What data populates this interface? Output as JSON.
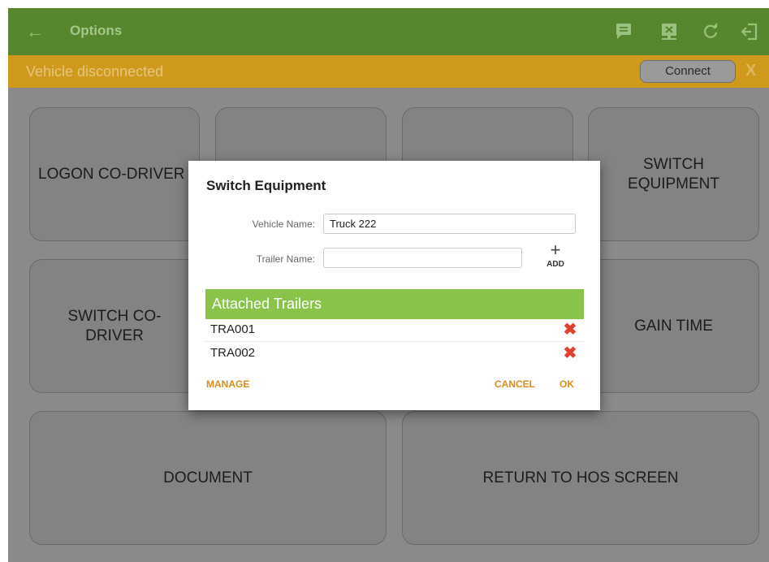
{
  "app_bar": {
    "back_glyph": "←",
    "title": "Options",
    "icons": [
      "message-icon",
      "device-disconnect-icon",
      "refresh-icon",
      "logout-icon"
    ],
    "color": "#56862d"
  },
  "status_bar": {
    "text": "Vehicle disconnected",
    "connect_label": "Connect",
    "dismiss_label": "X",
    "color": "#cf9a1b"
  },
  "tiles": {
    "logon_codriver": "LOGON CO-DRIVER",
    "switch_equipment": "SWITCH EQUIPMENT",
    "switch_codriver": "SWITCH CO-DRIVER",
    "gain_time": "GAIN TIME",
    "document": "DOCUMENT",
    "return_hos": "RETURN TO HOS SCREEN"
  },
  "dialog": {
    "title": "Switch Equipment",
    "vehicle_label": "Vehicle Name:",
    "vehicle_value": "Truck 222",
    "trailer_label": "Trailer Name:",
    "trailer_value": "",
    "add_glyph": "+",
    "add_label": "ADD",
    "attached_header": "Attached Trailers",
    "trailers": [
      {
        "name": "TRA001"
      },
      {
        "name": "TRA002"
      }
    ],
    "remove_glyph": "✖",
    "manage_label": "MANAGE",
    "cancel_label": "CANCEL",
    "ok_label": "OK",
    "accent_color": "#d98c1a",
    "header_color": "#8ac34a"
  }
}
